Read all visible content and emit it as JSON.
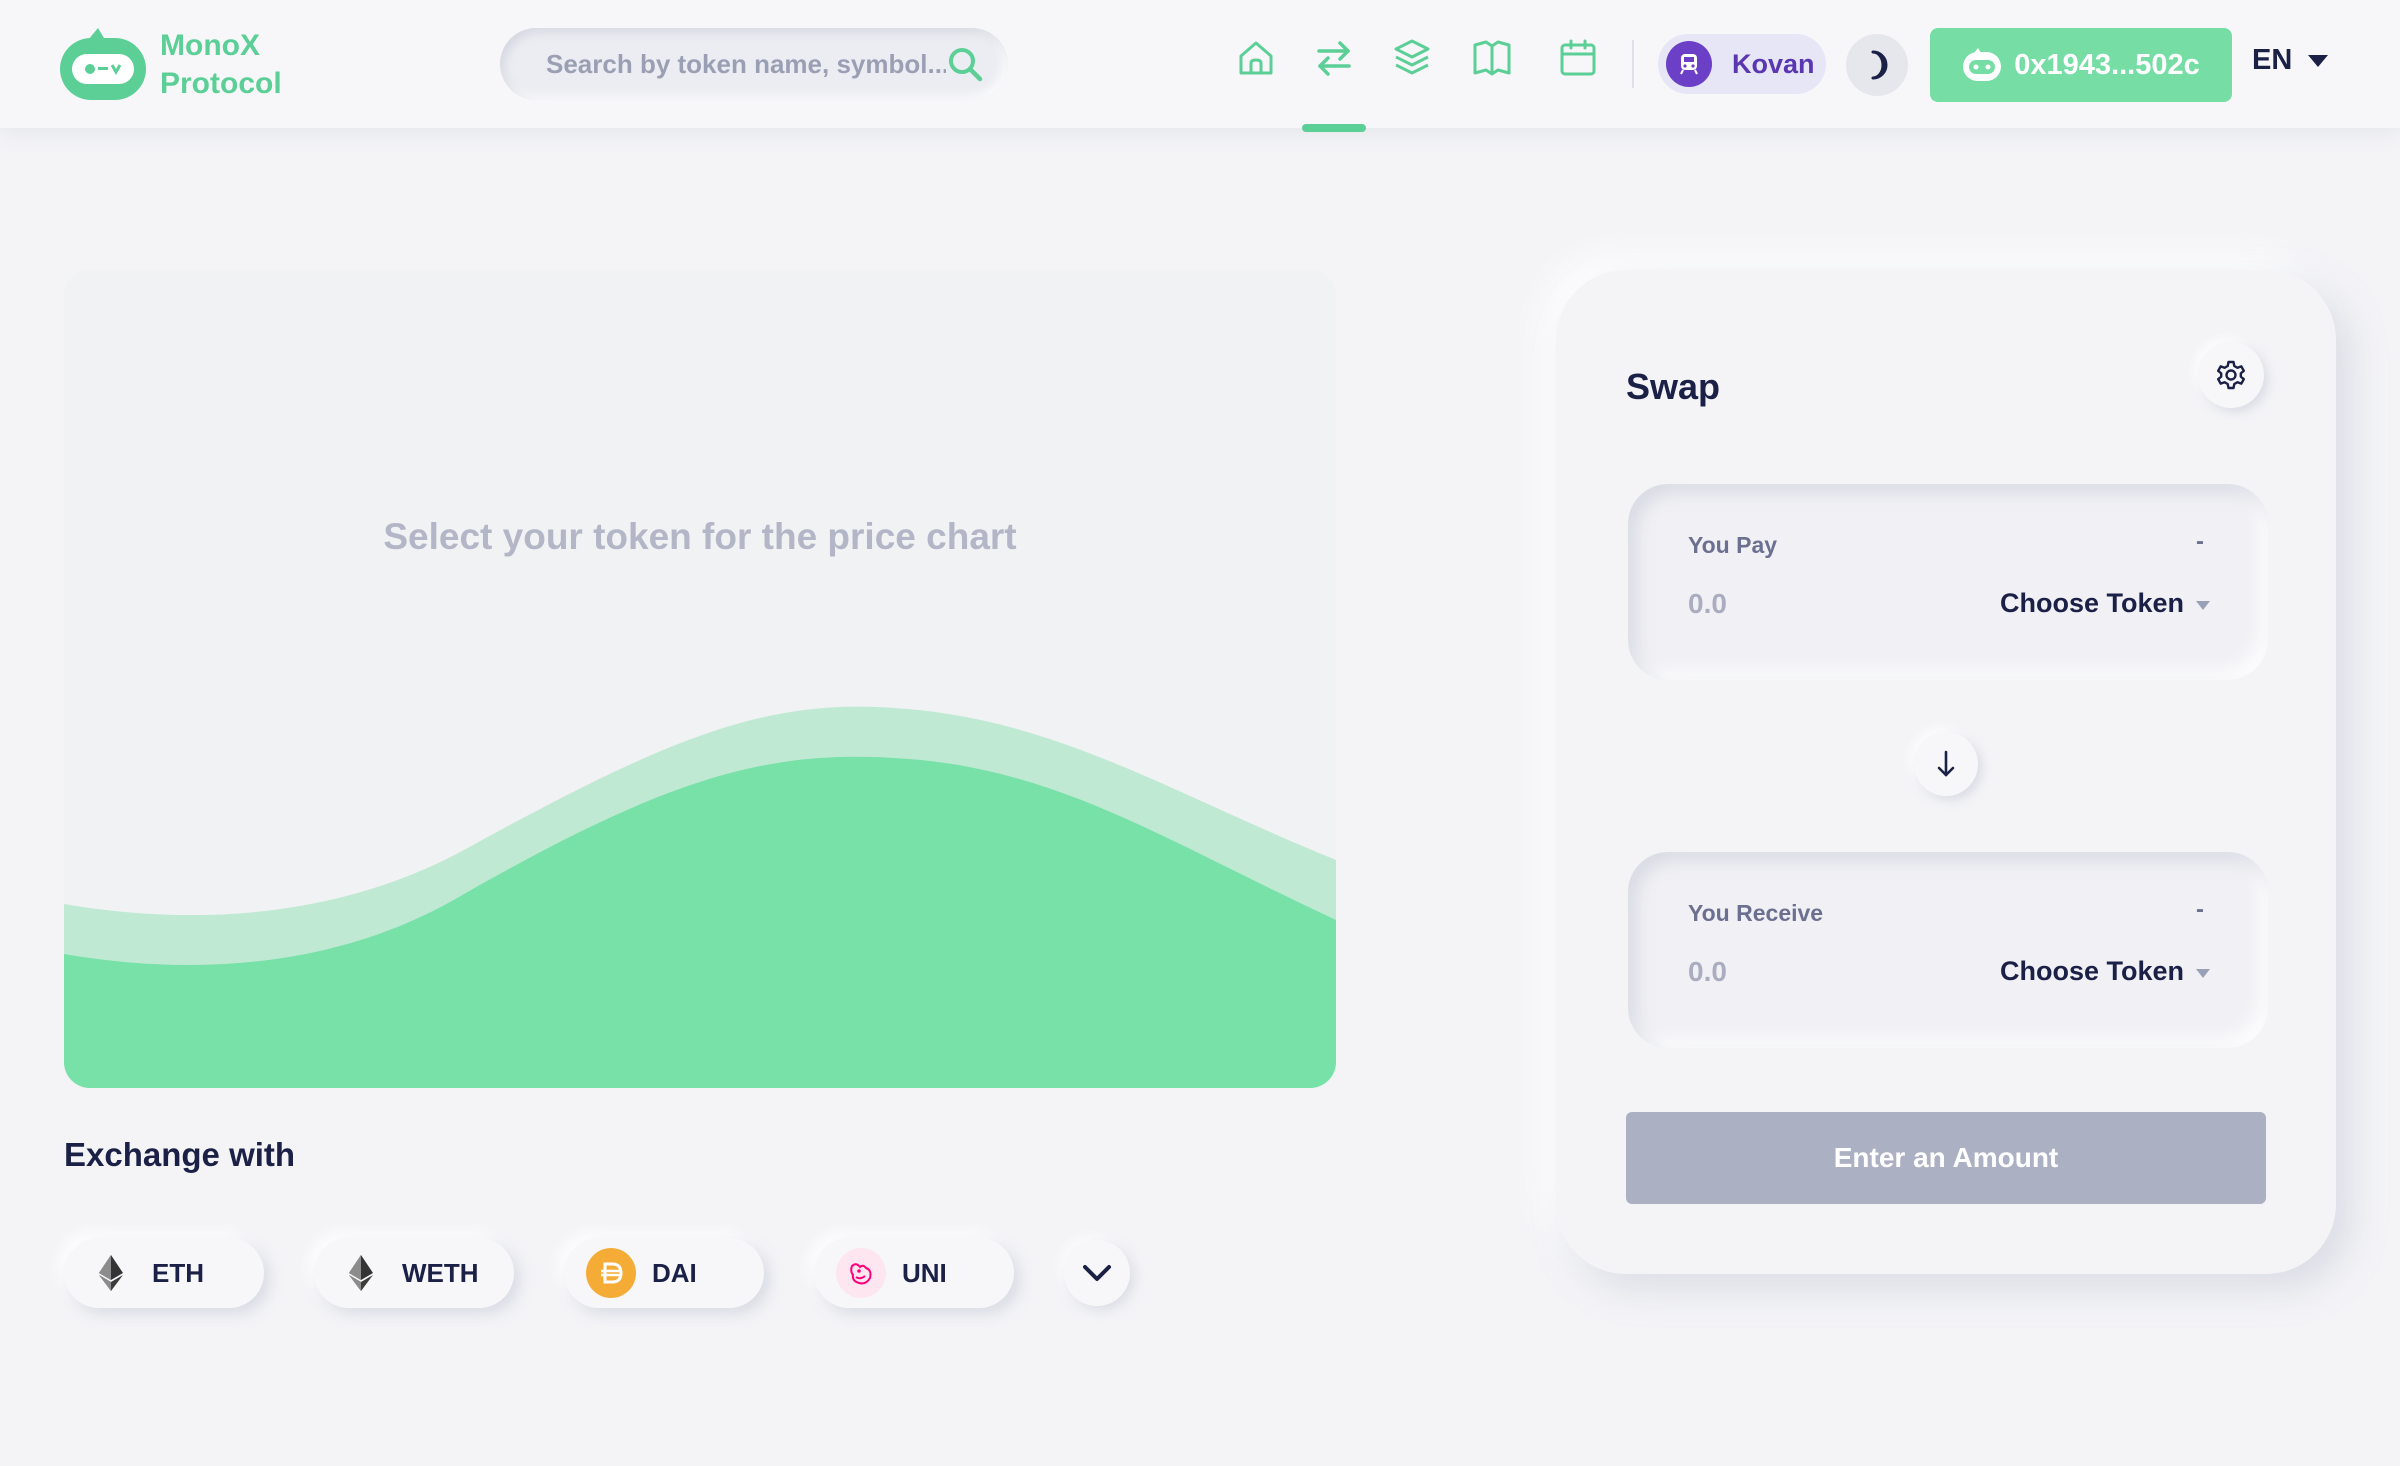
{
  "header": {
    "logo": {
      "line1": "MonoX",
      "line2": "Protocol"
    },
    "search": {
      "placeholder": "Search by token name, symbol..."
    },
    "nav": [
      {
        "name": "home-icon"
      },
      {
        "name": "swap-arrows-icon",
        "active": true
      },
      {
        "name": "layers-icon"
      },
      {
        "name": "book-icon"
      },
      {
        "name": "calendar-icon"
      }
    ],
    "network": {
      "label": "Kovan"
    },
    "wallet": {
      "address": "0x1943...502c"
    },
    "language": {
      "label": "EN"
    }
  },
  "chart": {
    "placeholder": "Select your token for the price chart"
  },
  "exchange": {
    "title": "Exchange with",
    "tokens": [
      {
        "symbol": "ETH",
        "icon": "ethereum-icon"
      },
      {
        "symbol": "WETH",
        "icon": "ethereum-icon"
      },
      {
        "symbol": "DAI",
        "icon": "dai-icon"
      },
      {
        "symbol": "UNI",
        "icon": "uniswap-icon"
      }
    ]
  },
  "swap": {
    "title": "Swap",
    "pay": {
      "label": "You Pay",
      "balance": "-",
      "placeholder": "0.0",
      "token_label": "Choose Token"
    },
    "receive": {
      "label": "You Receive",
      "balance": "-",
      "placeholder": "0.0",
      "token_label": "Choose Token"
    },
    "submit_label": "Enter an Amount"
  },
  "colors": {
    "accent": "#5ccf97",
    "wallet_bg": "#76dea5",
    "network": "#6b3fc6",
    "disabled_button": "#abb0c3",
    "text_dark": "#1b2046"
  }
}
